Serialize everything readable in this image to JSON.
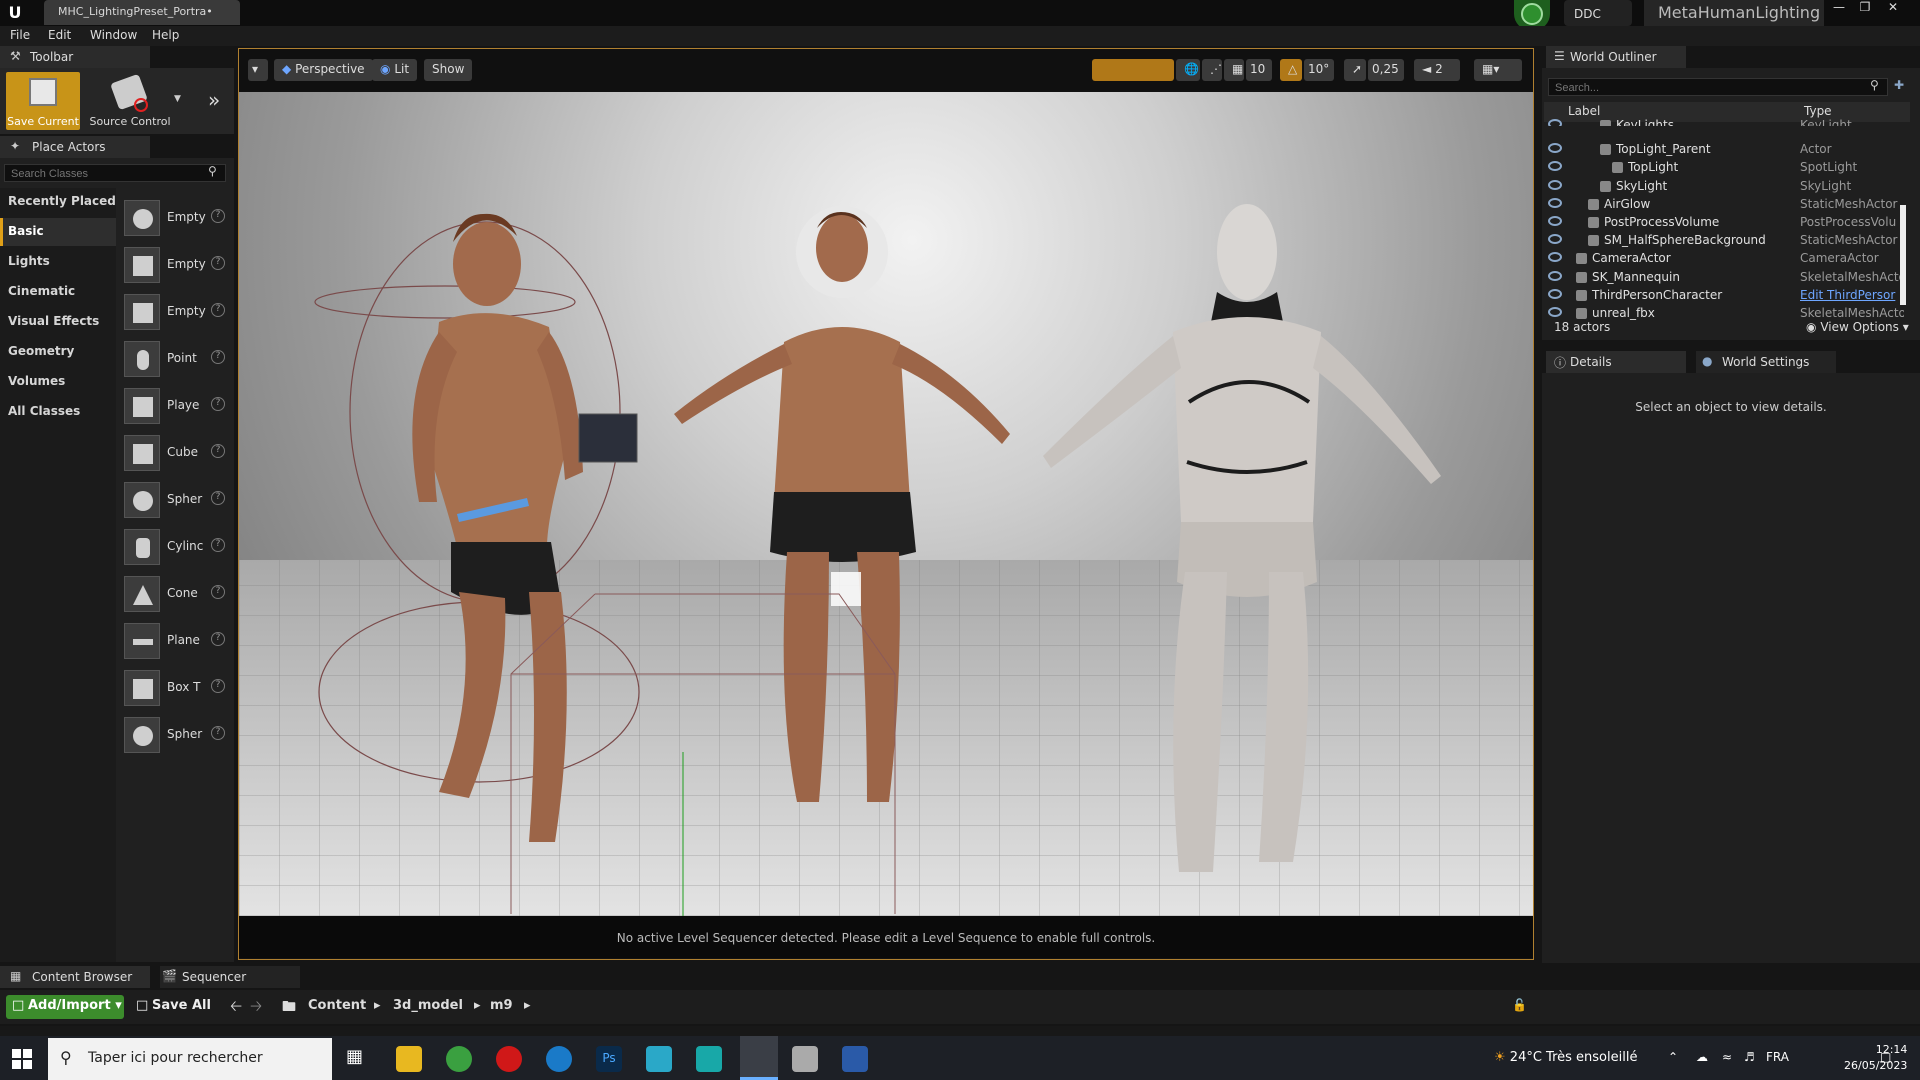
{
  "titlebar": {
    "doc_tab": "MHC_LightingPreset_Portra•",
    "ddc_label": "DDC",
    "project_name": "MetaHumanLighting"
  },
  "menu": [
    "File",
    "Edit",
    "Window",
    "Help"
  ],
  "toolbar": {
    "tab_label": "Toolbar",
    "save_current": "Save Current",
    "source_control": "Source Control"
  },
  "place_actors": {
    "tab_label": "Place Actors",
    "search_placeholder": "Search Classes",
    "categories": [
      "Recently Placed",
      "Basic",
      "Lights",
      "Cinematic",
      "Visual Effects",
      "Geometry",
      "Volumes",
      "All Classes"
    ],
    "active_category": "Basic",
    "items": [
      "Empty",
      "Empty",
      "Empty",
      "Point",
      "Playe",
      "Cube",
      "Spher",
      "Cylinc",
      "Cone",
      "Plane",
      "Box T",
      "Spher"
    ]
  },
  "viewport": {
    "perspective": "Perspective",
    "lit": "Lit",
    "show": "Show",
    "grid_snap": "10",
    "rot_snap": "10°",
    "scale_snap": "0,25",
    "cam_speed": "2",
    "status_message": "No active Level Sequencer detected. Please edit a Level Sequence to enable full controls."
  },
  "outliner": {
    "tab_label": "World Outliner",
    "search_placeholder": "Search...",
    "col_label": "Label",
    "col_type": "Type",
    "rows": [
      {
        "label": "KeyLights",
        "type": "KeyLight",
        "indent": 2,
        "partial": true
      },
      {
        "label": "TopLight_Parent",
        "type": "Actor",
        "indent": 2
      },
      {
        "label": "TopLight",
        "type": "SpotLight",
        "indent": 3
      },
      {
        "label": "SkyLight",
        "type": "SkyLight",
        "indent": 2
      },
      {
        "label": "AirGlow",
        "type": "StaticMeshActor",
        "indent": 1
      },
      {
        "label": "PostProcessVolume",
        "type": "PostProcessVolu",
        "indent": 1
      },
      {
        "label": "SM_HalfSphereBackground",
        "type": "StaticMeshActor",
        "indent": 1
      },
      {
        "label": "CameraActor",
        "type": "CameraActor",
        "indent": 0
      },
      {
        "label": "SK_Mannequin",
        "type": "SkeletalMeshActo",
        "indent": 0
      },
      {
        "label": "ThirdPersonCharacter",
        "type": "Edit ThirdPersor",
        "indent": 0,
        "link": true
      },
      {
        "label": "unreal_fbx",
        "type": "SkeletalMeshActo",
        "indent": 0
      }
    ],
    "actor_count": "18 actors",
    "view_options": "View Options"
  },
  "details": {
    "tab_label": "Details",
    "world_settings_label": "World Settings",
    "empty_message": "Select an object to view details."
  },
  "content_browser": {
    "tab_label": "Content Browser",
    "sequencer_label": "Sequencer",
    "add_import": "Add/Import",
    "save_all": "Save All",
    "path": [
      "Content",
      "3d_model",
      "m9"
    ]
  },
  "taskbar": {
    "search_placeholder": "Taper ici pour rechercher",
    "weather": "24°C  Très ensoleillé",
    "lang": "FRA",
    "time": "12:14",
    "date": "26/05/2023"
  },
  "colors": {
    "accent": "#e0a018",
    "add_import": "#3c8c2c",
    "link": "#6ea6ff",
    "viewport_border": "#b08030"
  }
}
